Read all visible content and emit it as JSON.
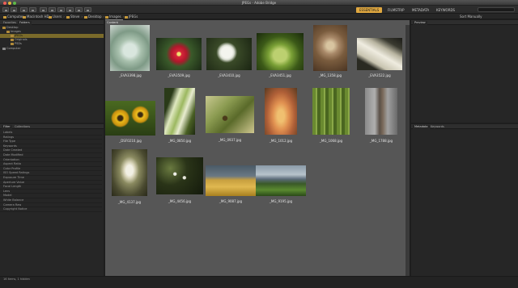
{
  "window": {
    "title": "JPEGs - Adobe Bridge",
    "traffic_colors": [
      "#ec5f57",
      "#e0b43b",
      "#5fb949"
    ]
  },
  "toolbar": {
    "workspaces": [
      "ESSENTIALS",
      "FILMSTRIP",
      "METADATA",
      "KEYWORDS"
    ],
    "active_workspace": "ESSENTIALS",
    "sort_label": "Sort Manually"
  },
  "path": {
    "items": [
      "Computer",
      "Macintosh HD",
      "Users",
      "Steve",
      "Desktop",
      "Images",
      "JPEGs"
    ]
  },
  "folders_panel": {
    "tabs": [
      "Favorites",
      "Folders"
    ],
    "active_tab": "Folders",
    "rows": [
      {
        "label": "Desktop",
        "level": 1
      },
      {
        "label": "Images",
        "level": 2
      },
      {
        "label": "JPEGs",
        "level": 3,
        "selected": true
      },
      {
        "label": "Originals",
        "level": 3
      },
      {
        "label": "PSDs",
        "level": 3
      },
      {
        "label": "Computer",
        "level": 0
      }
    ]
  },
  "metadata_panel": {
    "tabs": [
      "Filter",
      "Collections"
    ],
    "active_tab": "Filter",
    "rows": [
      "Labels",
      "Ratings",
      "File Type",
      "Keywords",
      "Date Created",
      "Date Modified",
      "Orientation",
      "Aspect Ratio",
      "Color Profile",
      "ISO Speed Ratings",
      "Exposure Time",
      "Aperture Value",
      "Focal Length",
      "Lens",
      "Model",
      "White Balance",
      "Camera Raw",
      "Copyright Notice"
    ]
  },
  "preview_panel": {
    "tabs": [
      "Preview"
    ]
  },
  "right_lower_panel": {
    "tabs": [
      "Metadata",
      "Keywords"
    ],
    "active_tab": "Metadata"
  },
  "content": {
    "tab_label": "Content",
    "thumbnails": [
      {
        "filename": "_EVA3398.jpg",
        "icon": "succulent-photo"
      },
      {
        "filename": "_EVA3509.jpg",
        "icon": "red-flower-photo"
      },
      {
        "filename": "_EVA3410.jpg",
        "icon": "dandelion-photo"
      },
      {
        "filename": "_EVA3451.jpg",
        "icon": "green-bud-photo"
      },
      {
        "filename": "_MG_1358.jpg",
        "icon": "dried-rose-photo"
      },
      {
        "filename": "_EVA3522.jpg",
        "icon": "white-petals-photo"
      },
      {
        "filename": "_DSF0210.jpg",
        "icon": "sunflowers-photo"
      },
      {
        "filename": "_MG_0850.jpg",
        "icon": "green-leaf-photo"
      },
      {
        "filename": "_MG_0937.jpg",
        "icon": "bee-leaf-photo"
      },
      {
        "filename": "_MG_1012.jpg",
        "icon": "orange-flower-photo"
      },
      {
        "filename": "_MG_1068.jpg",
        "icon": "grass-seeds-photo"
      },
      {
        "filename": "_MG_1788.jpg",
        "icon": "seedpod-photo"
      },
      {
        "filename": "_MG_4137.jpg",
        "icon": "white-blossom-photo"
      },
      {
        "filename": "_MG_4456.jpg",
        "icon": "dark-blossoms-photo"
      },
      {
        "filename": "_MG_9087.jpg",
        "icon": "wheat-field-photo"
      },
      {
        "filename": "_MG_9195.jpg",
        "icon": "farm-barn-photo"
      }
    ]
  },
  "status": {
    "text": "16 items, 1 hidden"
  }
}
